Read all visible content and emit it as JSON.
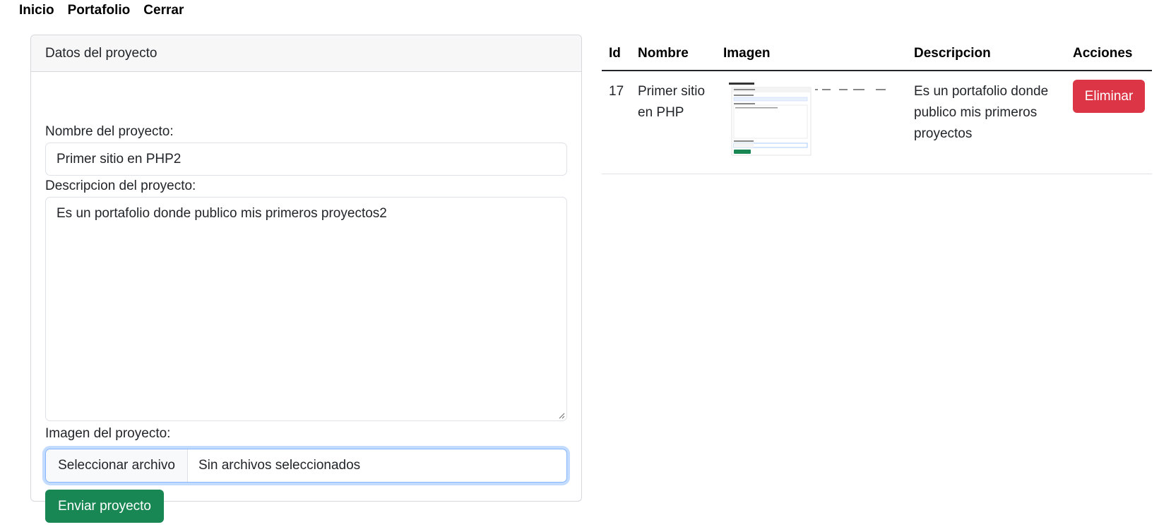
{
  "nav": {
    "items": [
      "Inicio",
      "Portafolio",
      "Cerrar"
    ]
  },
  "form": {
    "header": "Datos del proyecto",
    "name_label": "Nombre del proyecto:",
    "name_value": "Primer sitio en PHP2",
    "desc_label": "Descripcion del proyecto:",
    "desc_value": "Es un portafolio donde publico mis primeros proyectos2",
    "image_label": "Imagen del proyecto:",
    "file_button": "Seleccionar archivo",
    "file_status": "Sin archivos seleccionados",
    "submit_label": "Enviar proyecto"
  },
  "table": {
    "headers": [
      "Id",
      "Nombre",
      "Imagen",
      "Descripcion",
      "Acciones"
    ],
    "rows": [
      {
        "id": "17",
        "name": "Primer sitio en PHP",
        "image_icon": "project-screenshot-thumbnail",
        "description": "Es un portafolio donde publico mis primeros proyectos",
        "action_label": "Eliminar"
      }
    ]
  },
  "colors": {
    "success": "#198754",
    "danger": "#dc3545",
    "focus": "#86b7fe"
  }
}
